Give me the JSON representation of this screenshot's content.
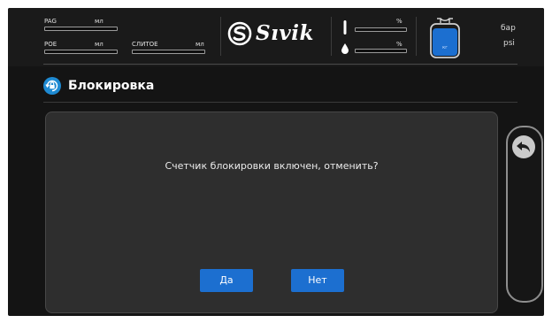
{
  "header": {
    "pag_label": "PAG",
    "pag_unit": "мл",
    "poe_label": "POE",
    "poe_unit": "мл",
    "drain_label": "СЛИТОЕ",
    "drain_unit": "мл",
    "brand": "Sıvik",
    "percent_1": "%",
    "percent_2": "%",
    "tank_label": "кг",
    "unit_bar": "бар",
    "unit_psi": "psi"
  },
  "title": {
    "text": "Блокировка"
  },
  "dialog": {
    "message": "Счетчик блокировки включен, отменить?",
    "yes_label": "Да",
    "no_label": "Нет"
  },
  "colors": {
    "accent_blue": "#1c6fd0",
    "title_icon_blue": "#1e8ad2",
    "screen_bg": "#141414",
    "dialog_bg": "#2e2e2e"
  },
  "icons": {
    "title": "lock-refresh-icon",
    "back": "back-arrow-icon",
    "brand": "sivik-logo-icon",
    "temperature": "thermometer-icon",
    "humidity": "droplet-icon",
    "tank": "refrigerant-tank-icon"
  }
}
